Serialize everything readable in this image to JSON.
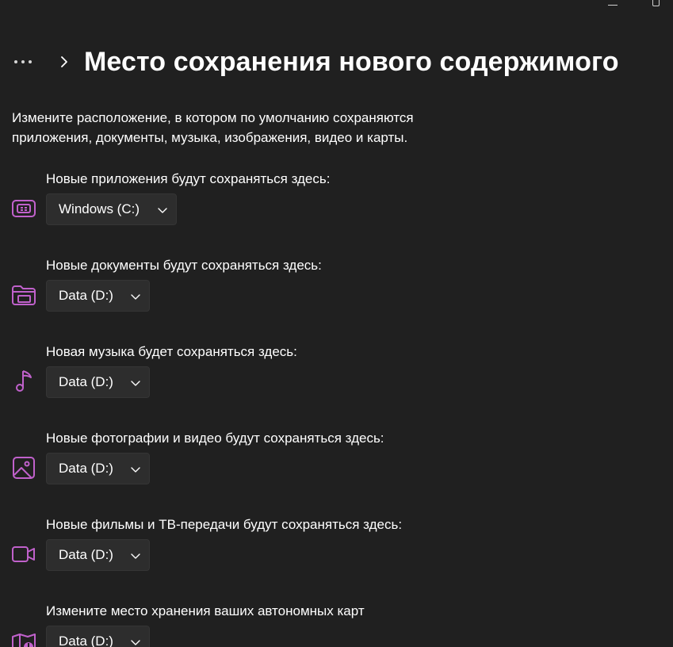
{
  "header": {
    "title": "Место сохранения нового содержимого"
  },
  "description": "Измените расположение, в котором по умолчанию сохраняются приложения, документы, музыка, изображения, видео и карты.",
  "accent_color": "#c061cb",
  "sections": [
    {
      "label": "Новые приложения будут сохраняться здесь:",
      "value": "Windows (C:)",
      "icon": "apps-storage-icon"
    },
    {
      "label": "Новые документы будут сохраняться здесь:",
      "value": "Data (D:)",
      "icon": "folder-documents-icon"
    },
    {
      "label": "Новая музыка будет сохраняться здесь:",
      "value": "Data (D:)",
      "icon": "music-note-icon"
    },
    {
      "label": "Новые фотографии и видео будут сохраняться здесь:",
      "value": "Data (D:)",
      "icon": "photo-icon"
    },
    {
      "label": "Новые фильмы и ТВ-передачи будут сохраняться здесь:",
      "value": "Data (D:)",
      "icon": "video-camera-icon"
    },
    {
      "label": "Измените место хранения ваших автономных карт",
      "value": "Data (D:)",
      "icon": "map-icon"
    }
  ]
}
